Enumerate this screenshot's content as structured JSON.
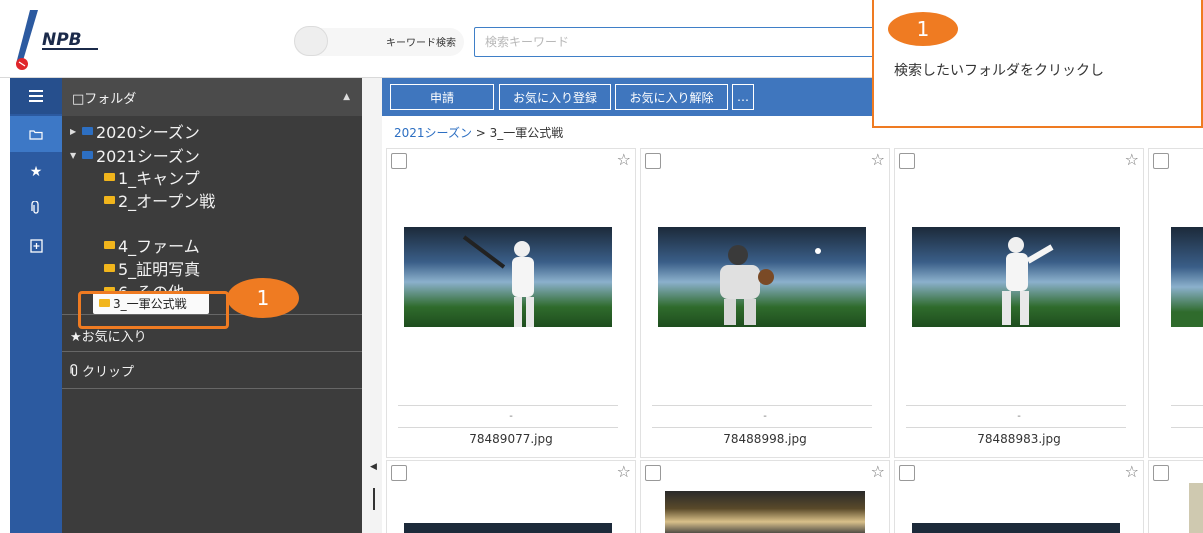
{
  "header": {
    "logo_text": "NPB",
    "keyword_search_label": "キーワード検索",
    "search_placeholder": "検索キーワード"
  },
  "rail": {
    "items": [
      "menu-icon",
      "folder-icon",
      "star-icon",
      "clip-icon",
      "add-file-icon"
    ]
  },
  "folder_panel": {
    "title": "□フォルダ",
    "tree": [
      {
        "label": "2020シーズン",
        "expanded": false
      },
      {
        "label": "2021シーズン",
        "expanded": true
      },
      {
        "label": "1_キャンプ"
      },
      {
        "label": "2_オープン戦"
      },
      {
        "label": "3_一軍公式戦",
        "selected": true
      },
      {
        "label": "4_ファーム"
      },
      {
        "label": "5_証明写真"
      },
      {
        "label": "6_その他"
      }
    ],
    "favorites": "★お気に入り",
    "clips": "クリップ"
  },
  "toolbar": {
    "apply": "申請",
    "fav_add": "お気に入り登録",
    "fav_remove": "お気に入り解除",
    "more": "…"
  },
  "breadcrumb": {
    "parent": "2021シーズン",
    "separator": " > ",
    "current": "3_一軍公式戦"
  },
  "cards": [
    {
      "dash": "-",
      "filename": "78489077.jpg"
    },
    {
      "dash": "-",
      "filename": "78488998.jpg"
    },
    {
      "dash": "-",
      "filename": "78488983.jpg"
    }
  ],
  "annotations": {
    "badge_number": "1",
    "callout_text": "検索したいフォルダをクリックし",
    "accent_color": "#ef7b22"
  }
}
